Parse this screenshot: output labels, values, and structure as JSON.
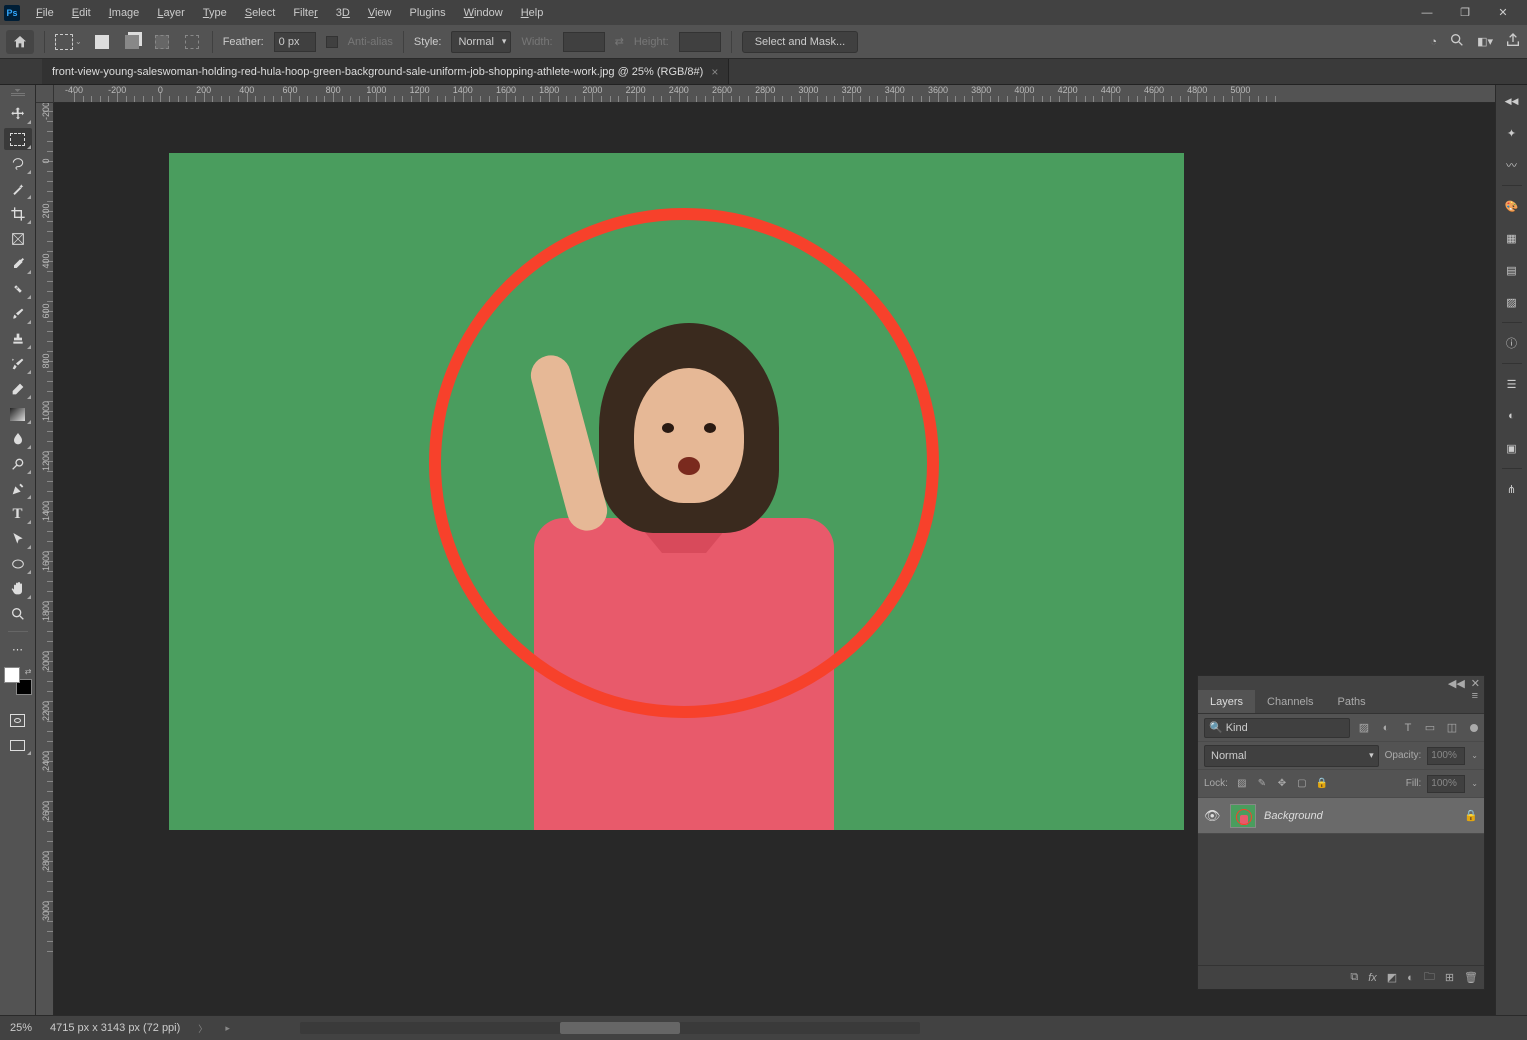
{
  "app": {
    "logo": "Ps"
  },
  "menu": [
    "File",
    "Edit",
    "Image",
    "Layer",
    "Type",
    "Select",
    "Filter",
    "3D",
    "View",
    "Plugins",
    "Window",
    "Help"
  ],
  "win_controls": {
    "min": "—",
    "max": "❐",
    "close": "✕"
  },
  "options": {
    "feather_label": "Feather:",
    "feather_value": "0 px",
    "antialias_label": "Anti-alias",
    "style_label": "Style:",
    "style_value": "Normal",
    "width_label": "Width:",
    "width_value": "",
    "height_label": "Height:",
    "height_value": "",
    "select_mask": "Select and Mask..."
  },
  "doc": {
    "tab_title": "front-view-young-saleswoman-holding-red-hula-hoop-green-background-sale-uniform-job-shopping-athlete-work.jpg @ 25% (RGB/8#)"
  },
  "ruler_h": [
    "-400",
    "-200",
    "0",
    "200",
    "400",
    "600",
    "800",
    "1000",
    "1200",
    "1400",
    "1600",
    "1800",
    "2000",
    "2200",
    "2400",
    "2600",
    "2800",
    "3000",
    "3200",
    "3400",
    "3600",
    "3800",
    "4000",
    "4200",
    "4400",
    "4600",
    "4800",
    "5000"
  ],
  "ruler_v": [
    "-200",
    "0",
    "200",
    "400",
    "600",
    "800",
    "1000",
    "1200",
    "1400",
    "1600",
    "1800",
    "2000",
    "2200",
    "2400",
    "2600",
    "2800",
    "3000"
  ],
  "tools": [
    "move",
    "marquee",
    "lasso",
    "wand",
    "crop",
    "frame",
    "eyedropper",
    "heal",
    "brush",
    "stamp",
    "history",
    "eraser",
    "gradient",
    "blur",
    "dodge",
    "pen",
    "type",
    "path",
    "rect",
    "hand",
    "zoom"
  ],
  "right_icons": [
    "history-panel",
    "keyframes",
    "color",
    "palette",
    "swatches",
    "gradients",
    "patterns",
    "info",
    "properties",
    "adjustments",
    "libraries",
    "comments"
  ],
  "panel": {
    "tabs": [
      "Layers",
      "Channels",
      "Paths"
    ],
    "active_tab": 0,
    "kind_label": "Kind",
    "blend_mode": "Normal",
    "opacity_label": "Opacity:",
    "opacity_value": "100%",
    "lock_label": "Lock:",
    "fill_label": "Fill:",
    "fill_value": "100%",
    "layers": [
      {
        "name": "Background",
        "locked": true,
        "visible": true
      }
    ],
    "footer_icons": [
      "link",
      "fx",
      "mask",
      "adj",
      "group",
      "new",
      "trash"
    ]
  },
  "status": {
    "zoom": "25%",
    "dims": "4715 px x 3143 px (72 ppi)"
  }
}
